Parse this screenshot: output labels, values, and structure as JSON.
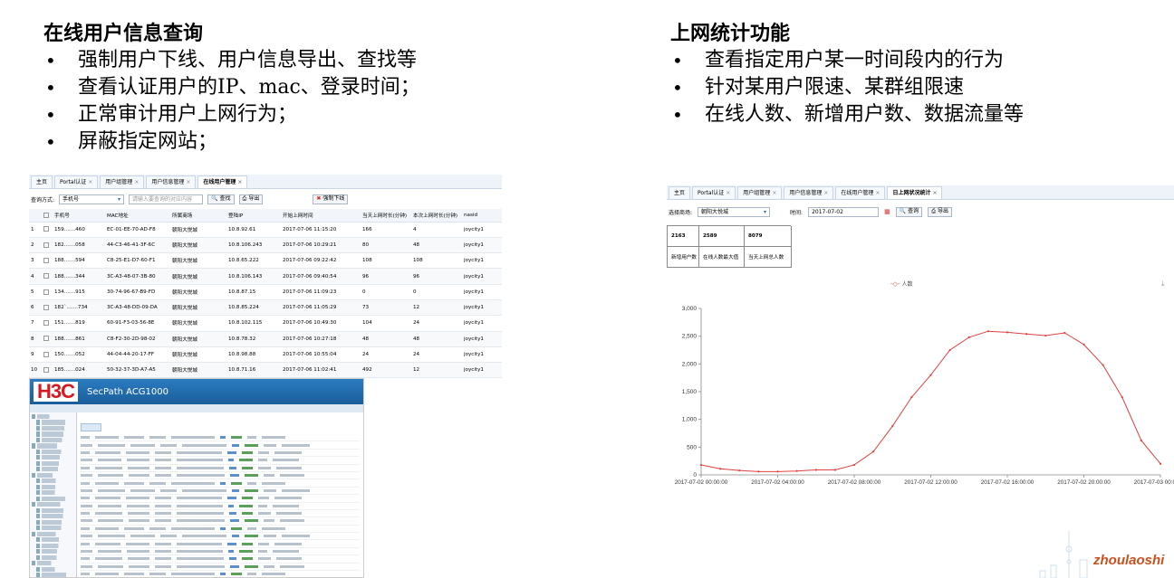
{
  "left_section": {
    "heading": "在线用户信息查询",
    "bullets": [
      "强制用户下线、用户信息导出、查找等",
      "查看认证用户的IP、mac、登录时间；",
      "正常审计用户上网行为；",
      "屏蔽指定网站；"
    ]
  },
  "right_section": {
    "heading": "上网统计功能",
    "bullets": [
      "查看指定用户某一时间段内的行为",
      "针对某用户限速、某群组限速",
      "在线人数、新增用户数、数据流量等"
    ]
  },
  "users_panel": {
    "tabs": [
      "主页",
      "Portal认证",
      "用户组管理",
      "用户信息管理",
      "在线用户管理"
    ],
    "active_tab": 4,
    "query_label": "查询方式:",
    "query_type": "手机号",
    "query_placeholder": "请输入要查询的对应内容",
    "search_label": "查找",
    "export_label": "导出",
    "force_offline_label": "强制下线",
    "columns": [
      "手机号",
      "MAC地址",
      "所属商场",
      "登陆IP",
      "开始上网时间",
      "当天上网时长(分钟)",
      "本次上网时长(分钟)",
      "nasid"
    ],
    "rows": [
      [
        "1",
        "159.......460",
        "EC-01-EE-70-AD-F8",
        "朝阳大悦城",
        "10.8.92.61",
        "2017-07-06 11:15:20",
        "166",
        "4",
        "joycity1"
      ],
      [
        "2",
        "182.......058",
        "44-C3-46-41-3F-6C",
        "朝阳大悦城",
        "10.8.106.243",
        "2017-07-06 10:29:21",
        "80",
        "48",
        "joycity1"
      ],
      [
        "3",
        "188.......594",
        "C8-25-E1-D7-60-F1",
        "朝阳大悦城",
        "10.8.65.222",
        "2017-07-06 09:22:42",
        "108",
        "108",
        "joycity1"
      ],
      [
        "4",
        "188.......344",
        "3C-A3-48-07-3B-80",
        "朝阳大悦城",
        "10.8.106.143",
        "2017-07-06 09:40:54",
        "96",
        "96",
        "joycity1"
      ],
      [
        "5",
        "134.......915",
        "30-74-96-67-B9-FD",
        "朝阳大悦城",
        "10.8.87.15",
        "2017-07-06 11:09:23",
        "0",
        "0",
        "joycity1"
      ],
      [
        "6",
        "182`.......734",
        "3C-A3-48-DD-09-DA",
        "朝阳大悦城",
        "10.8.85.224",
        "2017-07-06 11:05:29",
        "73",
        "12",
        "joycity1"
      ],
      [
        "7",
        "151.......819",
        "60-91-F3-03-56-8E",
        "朝阳大悦城",
        "10.8.102.115",
        "2017-07-06 10:49:30",
        "104",
        "24",
        "joycity1"
      ],
      [
        "8",
        "188.......861",
        "C8-F2-30-2D-98-02",
        "朝阳大悦城",
        "10.8.78.32",
        "2017-07-06 10:27:18",
        "48",
        "48",
        "joycity1"
      ],
      [
        "9",
        "150.......052",
        "44-04-44-20-17-FF",
        "朝阳大悦城",
        "10.8.98.88",
        "2017-07-06 10:55:04",
        "24",
        "24",
        "joycity1"
      ],
      [
        "10",
        "185.......024",
        "50-32-37-3D-A7-A5",
        "朝阳大悦城",
        "10.8.71.16",
        "2017-07-06 11:02:41",
        "492",
        "12",
        "joycity1"
      ]
    ]
  },
  "h3c_panel": {
    "logo": "H3C",
    "product": "SecPath ACG1000"
  },
  "stats_panel": {
    "tabs": [
      "主页",
      "Portal认证",
      "用户组管理",
      "用户信息管理",
      "在线用户管理",
      "日上网状况统计"
    ],
    "active_tab": 5,
    "mall_label": "选择商场:",
    "mall_value": "朝阳大悦城",
    "time_label": "时间:",
    "time_value": "2017-07-02",
    "search_label": "查询",
    "export_label": "导出",
    "stats": [
      {
        "value": "2163",
        "label": "新增用户数"
      },
      {
        "value": "2589",
        "label": "在线人数最大值"
      },
      {
        "value": "8079",
        "label": "当天上网总人数"
      }
    ],
    "legend": "人数"
  },
  "chart_data": {
    "type": "line",
    "x": [
      "2017-07-02 00:00:00",
      "2017-07-02 02:00:00",
      "2017-07-02 04:00:00",
      "2017-07-02 06:00:00",
      "2017-07-02 08:00:00",
      "2017-07-02 10:00:00",
      "2017-07-02 12:00:00",
      "2017-07-02 14:00:00",
      "2017-07-02 16:00:00",
      "2017-07-02 18:00:00",
      "2017-07-02 20:00:00",
      "2017-07-02 22:00:00",
      "2017-07-03 00:00:00"
    ],
    "x_ticks": [
      "2017-07-02 00:00:00",
      "2017-07-02 04:00:00",
      "2017-07-02 08:00:00",
      "2017-07-02 12:00:00",
      "2017-07-02 16:00:00",
      "2017-07-02 20:00:00",
      "2017-07-03 00:00:00"
    ],
    "series": [
      {
        "name": "人数",
        "values": [
          180,
          110,
          80,
          60,
          60,
          70,
          90,
          90,
          180,
          420,
          880,
          1400,
          1800,
          2250,
          2480,
          2589,
          2570,
          2540,
          2510,
          2560,
          2350,
          1980,
          1400,
          620,
          200
        ],
        "x_step_hours": 1
      }
    ],
    "ylim": [
      0,
      3000
    ],
    "yticks": [
      0,
      500,
      1000,
      1500,
      2000,
      2500,
      3000
    ],
    "color": "#e04040",
    "grid": false,
    "legend": "top-center"
  },
  "watermark": "zhoulaoshi"
}
